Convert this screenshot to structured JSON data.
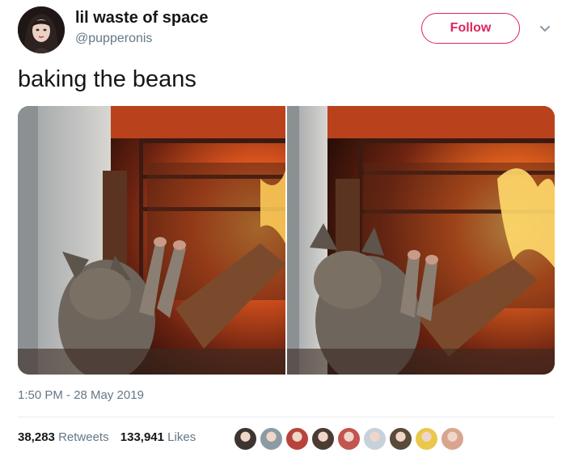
{
  "user": {
    "display_name": "lil waste of space",
    "handle": "@pupperonis",
    "avatar_icon": "profile-avatar"
  },
  "follow_button": {
    "label": "Follow",
    "color": "#e0245e"
  },
  "menu_icon": "chevron-down-icon",
  "tweet": {
    "text": "baking the beans",
    "timestamp": "1:50 PM - 28 May 2019"
  },
  "media": {
    "photos": [
      {
        "subject": "cat-warming-paws-at-fire-photo"
      },
      {
        "subject": "cat-warming-paws-at-fire-photo"
      }
    ]
  },
  "stats": {
    "retweets_count": "38,283",
    "retweets_label": "Retweets",
    "likes_count": "133,941",
    "likes_label": "Likes"
  },
  "likers": [
    {
      "color": "#3b3431"
    },
    {
      "color": "#8c9aa3"
    },
    {
      "color": "#b8433d"
    },
    {
      "color": "#4b3c33"
    },
    {
      "color": "#c2554f"
    },
    {
      "color": "#c7d1da"
    },
    {
      "color": "#5a4a3a"
    },
    {
      "color": "#e9c84a"
    },
    {
      "color": "#d9a58f"
    }
  ]
}
